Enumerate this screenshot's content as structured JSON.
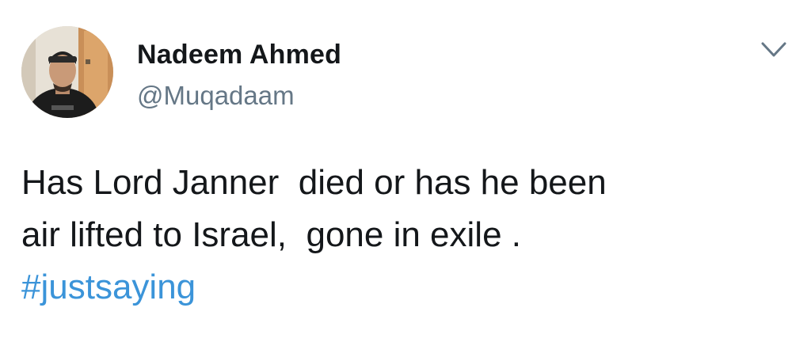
{
  "author": {
    "name": "Nadeem Ahmed",
    "handle": "@Muqadaam",
    "avatar_icon": "profile-photo"
  },
  "menu": {
    "icon": "chevron-down-icon"
  },
  "tweet": {
    "line1": "Has Lord Janner  died or has he been",
    "line2": "air lifted to Israel,  gone in exile .",
    "hashtag": "#justsaying"
  },
  "colors": {
    "text": "#14171a",
    "handle": "#657786",
    "link": "#3b94d9",
    "chevron": "#657786"
  }
}
